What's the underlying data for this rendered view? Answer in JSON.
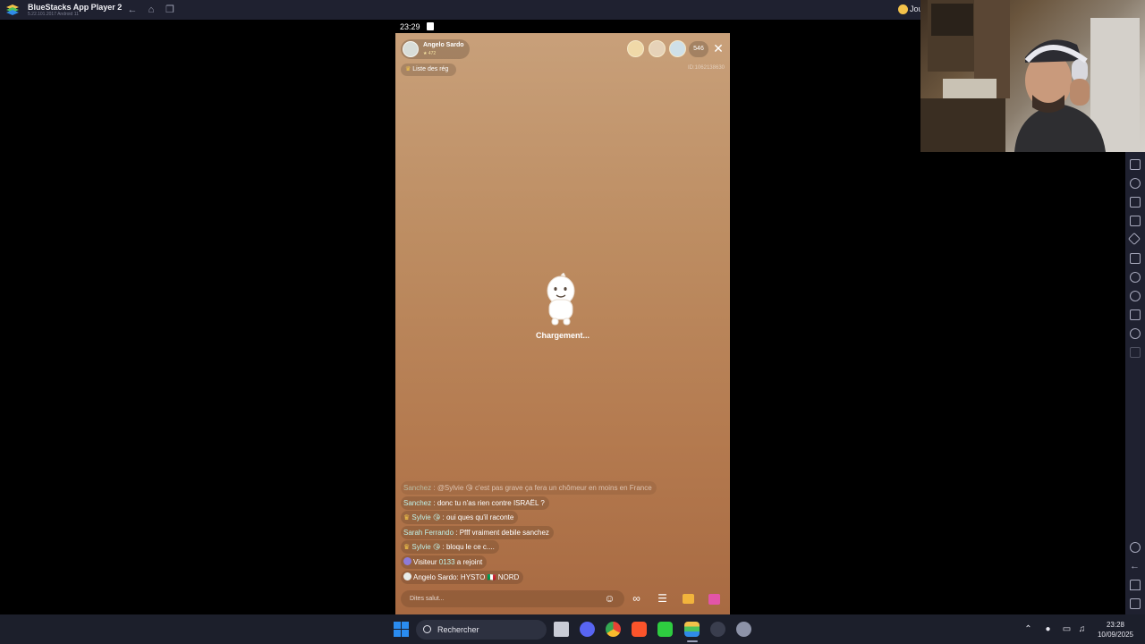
{
  "titlebar": {
    "app_title": "BlueStacks App Player 2",
    "app_version": "5.22.101.2017  Android 11",
    "right_label": "Jou"
  },
  "android": {
    "time": "23:29"
  },
  "live": {
    "host_name": "Angelo Sardo",
    "host_sub": "★ 472",
    "viewer_count": "546",
    "room_id": "ID:1062138630",
    "reg_list_label": "Liste des rég",
    "loading_text": "Chargement...",
    "input_placeholder": "Dites salut..."
  },
  "chat": [
    {
      "user": "Sanchez",
      "sep": " : ",
      "text": "@Sylvie 😘 c'est pas grave ça fera un chômeur en moins en France",
      "crown": false,
      "faded": true
    },
    {
      "user": "Sanchez",
      "sep": " : ",
      "text": "donc tu n'as rien contre ISRAËL ?",
      "crown": false,
      "faded": false
    },
    {
      "user": "Sylvie 😘",
      "sep": " : ",
      "text": "oui ques qu'il raconte",
      "crown": true,
      "faded": false
    },
    {
      "user": "Sarah Ferrando",
      "sep": " : ",
      "text": "Pfff vraiment debile sanchez",
      "crown": false,
      "faded": false
    },
    {
      "user": "Sylvie 😘",
      "sep": " : ",
      "text": "bloqu le ce c....",
      "crown": true,
      "faded": false
    }
  ],
  "join_msg": {
    "prefix": "Visiteur ",
    "user": "0133",
    "text": " a rejoint"
  },
  "host_msg": {
    "text": "Angelo Sardo: HYSTO 🇮🇹  NORD"
  },
  "taskbar": {
    "search_label": "Rechercher",
    "time": "23:28",
    "date": "10/09/2025"
  },
  "colors": {
    "titlebar_bg": "#1f2130",
    "phone_bg_top": "#c8a07a",
    "phone_bg_bottom": "#a86a42",
    "chat_username": "#bff0e6",
    "taskbar_bg": "#1c1f2b",
    "windows_blue": "#2a8cf0"
  }
}
